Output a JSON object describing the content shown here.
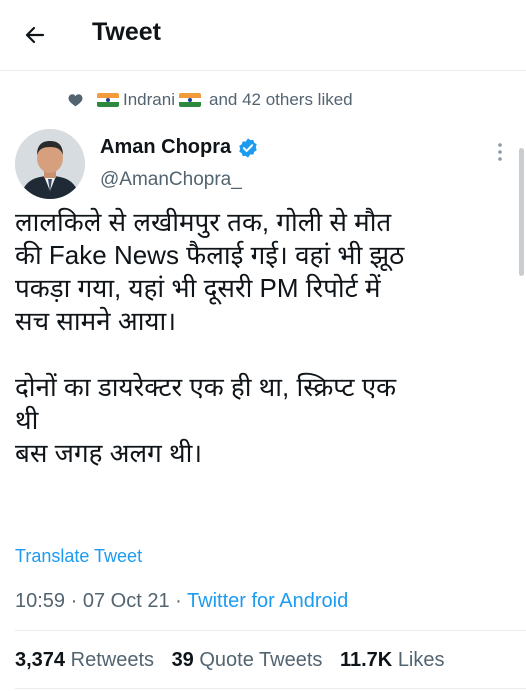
{
  "header": {
    "title": "Tweet",
    "back_icon": "arrow-left-icon"
  },
  "social_context": {
    "icon": "heart-icon",
    "liker_name": "Indrani",
    "flag_icon": "india-flag-icon",
    "liked_rest": "and 42 others liked"
  },
  "tweet": {
    "author_name": "Aman Chopra",
    "verified_icon": "verified-badge-icon",
    "handle": "@AmanChopra_",
    "text_lines": [
      "लालकिले से लखीमपुर तक, गोली से मौत",
      "की Fake News फैलाई गई। वहां भी झूठ",
      "पकड़ा गया, यहां भी दूसरी PM रिपोर्ट में",
      "सच सामने आया।",
      "दोनों का डायरेक्टर एक ही था, स्क्रिप्ट एक",
      "थी",
      "बस जगह अलग थी।"
    ],
    "translate_label": "Translate Tweet",
    "time": "10:59",
    "date": "07 Oct 21",
    "separator": "·",
    "source": "Twitter for Android"
  },
  "stats": {
    "retweets_count": "3,374",
    "retweets_label": "Retweets",
    "quotes_count": "39",
    "quotes_label": "Quote Tweets",
    "likes_count": "11.7K",
    "likes_label": "Likes"
  },
  "colors": {
    "accent": "#1d9bf0",
    "secondary_text": "#536471",
    "primary_text": "#0f1419",
    "divider": "#e6ecf0"
  }
}
